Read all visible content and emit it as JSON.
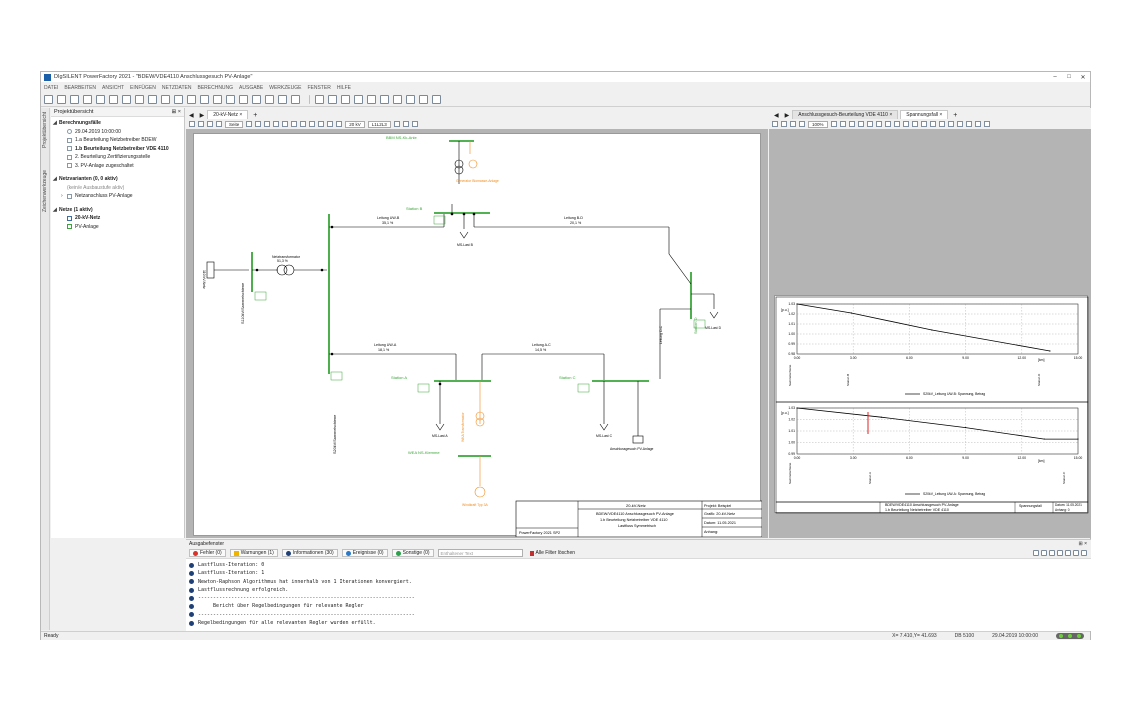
{
  "window": {
    "title": "DIgSILENT PowerFactory 2021 - \"BDEW/VDE4110 Anschlussgesuch PV-Anlage\"",
    "minimize": "–",
    "maximize": "□",
    "close": "✕"
  },
  "menu": [
    "DATEI",
    "BEARBEITEN",
    "ANSICHT",
    "EINFÜGEN",
    "NETZDATEN",
    "BERECHNUNG",
    "AUSGABE",
    "WERKZEUGE",
    "FENSTER",
    "HILFE"
  ],
  "left_strip": {
    "tab1": "Projektübersicht",
    "tab2": "Zeichenwerkzeuge"
  },
  "project": {
    "header": "Projektübersicht",
    "pin": "⊞ ×",
    "calc_header": "Berechnungsfälle",
    "calc_items": [
      {
        "label": "29.04.2019 10:00:00",
        "bold": false
      },
      {
        "label": "1.a Beurteilung Netzbetreiber BDEW",
        "bold": false
      },
      {
        "label": "1.b Beurteilung Netzbetreiber VDE 4110",
        "bold": true
      },
      {
        "label": "2. Beurteilung Zertifizierungsstelle",
        "bold": false
      },
      {
        "label": "3. PV-Anlage zugeschaltet",
        "bold": false
      }
    ],
    "variants_header": "Netzvarianten (0, 0 aktiv)",
    "variants_items": [
      "(kein/e Ausbaustufe aktiv)",
      "Netzanschluss PV-Anlage"
    ],
    "nets_header": "Netze (1 aktiv)",
    "nets_items": [
      "20-kV-Netz",
      "PV-Anlage"
    ]
  },
  "diagram": {
    "tab": "20-kV-Netz",
    "page_box": "Seite",
    "voltage_box": "20 kV",
    "layer_box": "L1L2L3",
    "labels": {
      "bbm_hv": "BBM NS-Kk-Anle",
      "gen_bbm": "Generator Biomasse-Anlage",
      "station_b": "Station B",
      "lt_uw_b": "Leitung UW-B",
      "lt_uw_b_pct": "35,1 %",
      "lt_b_d": "Leitung B-D",
      "lt_b_d_pct": "20,1 %",
      "ms_last_b": "MS-Last B",
      "netztrafo": "Netztransformator",
      "netztrafo_pct": "51,3 %",
      "ext_grid": "110 kV-Netz",
      "bus_110": "S110kV/Sammelschiene",
      "bus_20": "S20kV/Sammelschiene",
      "station_d": "Station D",
      "ms_last_d": "MS-Last D",
      "lt_uw_a": "Leitung UW-A",
      "lt_uw_a_pct": "18,1 %",
      "lt_a_c": "Leitung A-C",
      "lt_a_c_pct": "14,5 %",
      "lt_d_c": "Leitung D-C",
      "station_a": "Station A",
      "ms_last_a": "MS-Last A",
      "station_c": "Station C",
      "ms_last_c": "MS-Last C",
      "anschluss_pv": "Anschlussgesuch PV-Anlage",
      "wea_ns": "WEA NS-Klemme",
      "wka_typ": "Windkraft Typ 3A",
      "trafo_a": "WKA Transformator"
    },
    "titleblock": {
      "net": "20-kV-Netz",
      "line1": "BDEW/VDE4110 Anschlussgesuch PV-Anlage",
      "line2": "1.b Beurteilung Netzbetreiber VDE 4110",
      "line3": "Lastfluss Symmetrisch",
      "software": "PowerFactory 2021 SP2",
      "projekt": "Projekt: Beispiel",
      "grafik": "Grafik: 20-kV-Netz",
      "datum": "Datum:    11.05.2021",
      "anhang": "Anhang:"
    }
  },
  "right": {
    "tab1": "Anschlussgesuch-Beurteilung VDE 4110",
    "tab2": "Spannungsfall",
    "zoom": "100%",
    "plot1": {
      "ylabel": "[p.u.]",
      "yticks": [
        "1.03",
        "1.02",
        "1.01",
        "1.00",
        "0.99",
        "0.98"
      ],
      "xticks": [
        "0.00",
        "3.00",
        "6.00",
        "9.00",
        "12.00",
        "15.00"
      ],
      "xunit": "[km]",
      "xcats": [
        "Sammelschiene",
        "Station B",
        "Station D"
      ],
      "legend": "S20kV_Leitung UW-B: Spannung, Betrag"
    },
    "plot2": {
      "ylabel": "[p.u.]",
      "yticks": [
        "1.03",
        "1.02",
        "1.01",
        "1.00",
        "0.99"
      ],
      "xticks": [
        "0.00",
        "3.00",
        "6.00",
        "9.00",
        "12.00",
        "15.00"
      ],
      "xunit": "[km]",
      "xcats": [
        "Sammelschiene",
        "Station A",
        "Station C"
      ],
      "legend": "S20kV_Leitung UW-A: Spannung, Betrag"
    },
    "footer": {
      "line1": "BDEW/VDE4110 Anschlussgesuch PV-Anlage",
      "line2": "1.b Beurteilung Netzbetreiber VDE 4110",
      "name": "Spannungsfall",
      "datum": "Datum: 11.05.2021",
      "anhang": "Anhang:     0"
    }
  },
  "chart_data": [
    {
      "type": "line",
      "title": "",
      "xlabel": "[km]",
      "ylabel": "[p.u.]",
      "xlim": [
        0,
        15
      ],
      "ylim": [
        0.98,
        1.03
      ],
      "grid": true,
      "series": [
        {
          "name": "S20kV_Leitung UW-B: Spannung, Betrag",
          "x": [
            0.0,
            2.9,
            7.2,
            13.5
          ],
          "y": [
            1.03,
            1.021,
            1.004,
            0.983
          ]
        }
      ]
    },
    {
      "type": "line",
      "title": "",
      "xlabel": "[km]",
      "ylabel": "[p.u.]",
      "xlim": [
        0,
        15
      ],
      "ylim": [
        0.99,
        1.03
      ],
      "grid": true,
      "series": [
        {
          "name": "S20kV_Leitung UW-A: Spannung, Betrag",
          "x": [
            0.0,
            4.5,
            9.0,
            13.2,
            15.0
          ],
          "y": [
            1.03,
            1.022,
            1.013,
            1.003,
            1.003
          ]
        }
      ]
    }
  ],
  "output": {
    "header": "Ausgabefenster",
    "pin": "⊞ ×",
    "filters": [
      "Fehler (0)",
      "Warnungen (1)",
      "Informationen (30)",
      "Ereignisse (0)",
      "Sonstige (0)"
    ],
    "search_placeholder": "Enthaltener Text",
    "clear": "Alle Filter löschen",
    "lines": [
      "Lastfluss-Iteration: 0",
      "Lastfluss-Iteration: 1",
      "Newton-Raphson Algorithmus hat innerhalb von 1 Iterationen konvergiert.",
      "Lastflussrechnung erfolgreich.",
      "------------------------------------------------------------------------",
      "     Bericht über Regelbedingungen für relevante Regler",
      "------------------------------------------------------------------------",
      "Regelbedingungen für alle relevanten Regler wurden erfüllt."
    ]
  },
  "status": {
    "ready": "Ready",
    "coords": "X=    7.410,Y=    41.693",
    "db": "DB 5100",
    "time": "29.04.2019 10:00:00"
  },
  "colors": {
    "bus": "#3aa63a",
    "orange": "#f08c1e",
    "red": "#e02020"
  }
}
